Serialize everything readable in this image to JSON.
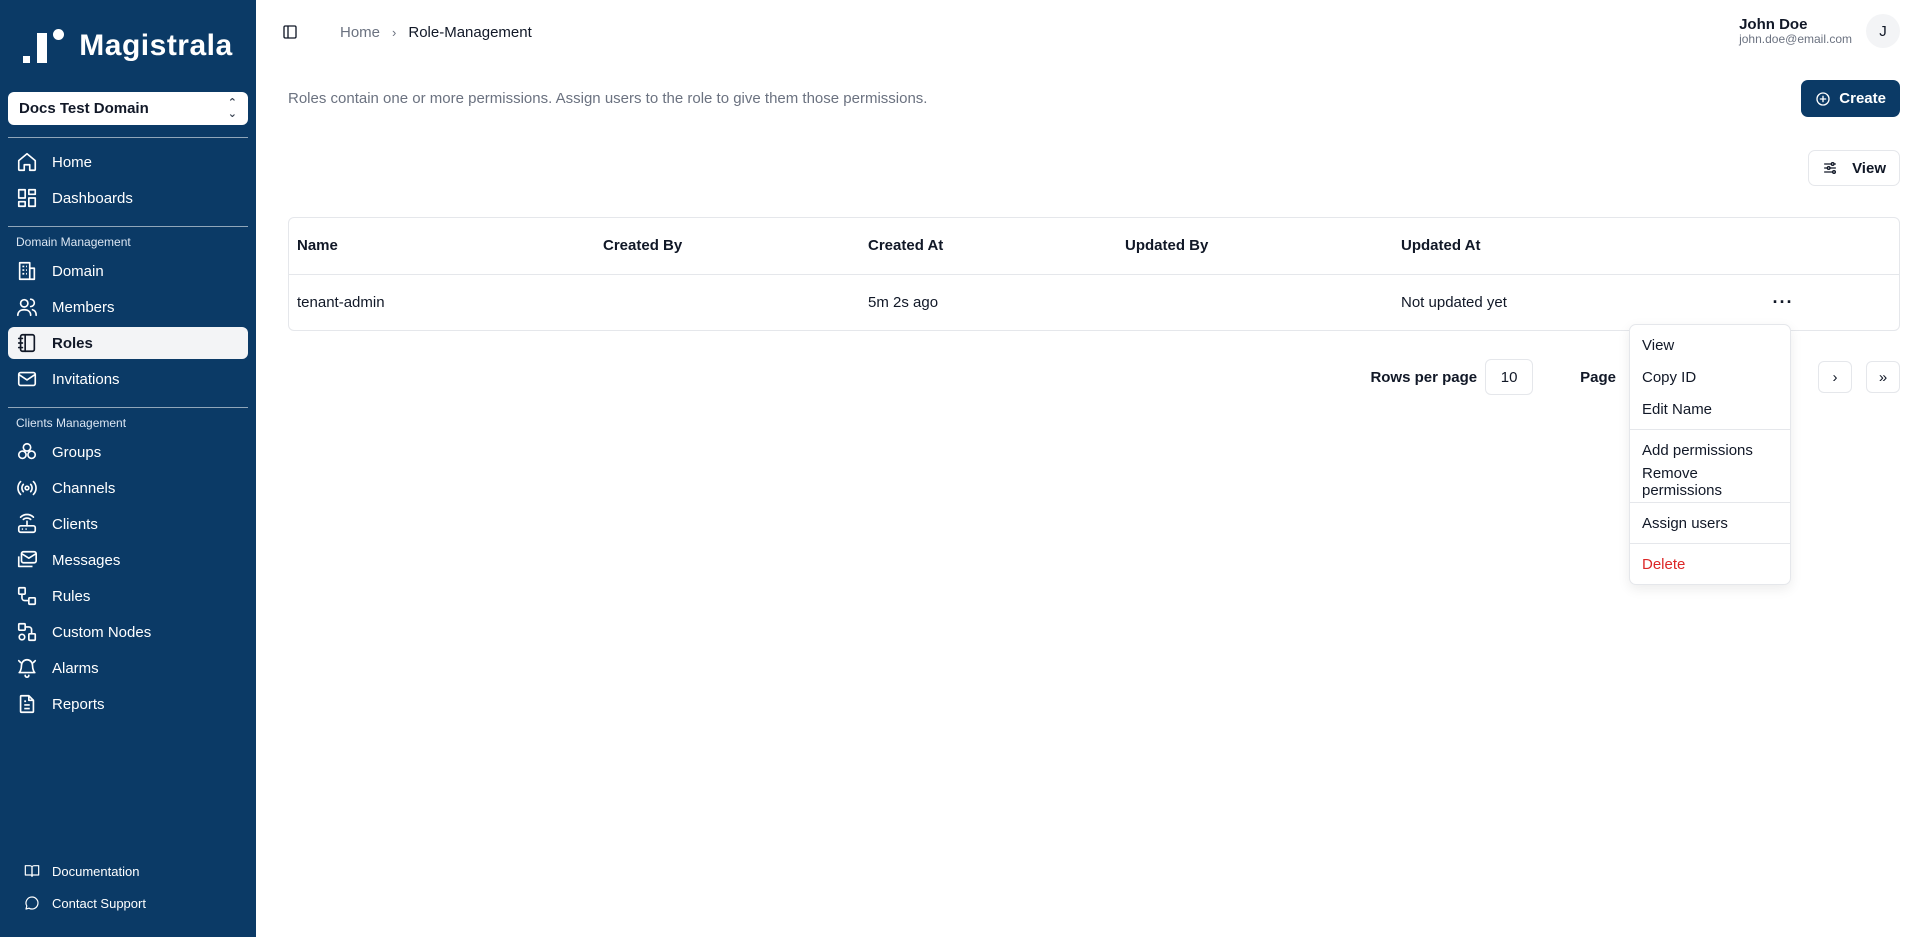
{
  "brand": {
    "name": "Magistrala"
  },
  "domain_selector": {
    "value": "Docs Test Domain"
  },
  "sidebar": {
    "main_items": [
      {
        "label": "Home",
        "icon": "home-icon"
      },
      {
        "label": "Dashboards",
        "icon": "dashboard-icon"
      }
    ],
    "domain_section": {
      "label": "Domain Management",
      "items": [
        {
          "label": "Domain",
          "icon": "building-icon"
        },
        {
          "label": "Members",
          "icon": "users-icon"
        },
        {
          "label": "Roles",
          "icon": "notebook-icon",
          "active": true
        },
        {
          "label": "Invitations",
          "icon": "mail-icon"
        }
      ]
    },
    "clients_section": {
      "label": "Clients Management",
      "items": [
        {
          "label": "Groups",
          "icon": "groups-icon"
        },
        {
          "label": "Channels",
          "icon": "radio-icon"
        },
        {
          "label": "Clients",
          "icon": "router-icon"
        },
        {
          "label": "Messages",
          "icon": "messages-icon"
        },
        {
          "label": "Rules",
          "icon": "workflow-icon"
        },
        {
          "label": "Custom Nodes",
          "icon": "nodes-icon"
        },
        {
          "label": "Alarms",
          "icon": "bell-icon"
        },
        {
          "label": "Reports",
          "icon": "file-icon"
        }
      ]
    },
    "bottom_items": [
      {
        "label": "Documentation",
        "icon": "book-icon"
      },
      {
        "label": "Contact Support",
        "icon": "chat-icon"
      }
    ]
  },
  "header": {
    "breadcrumb": {
      "home": "Home",
      "separator": "›",
      "current": "Role-Management"
    },
    "user": {
      "name": "John Doe",
      "email": "john.doe@email.com",
      "initial": "J"
    }
  },
  "page": {
    "description": "Roles contain one or more permissions. Assign users to the role to give them those permissions.",
    "create_label": "Create",
    "view_label": "View"
  },
  "table": {
    "columns": [
      "Name",
      "Created By",
      "Created At",
      "Updated By",
      "Updated At"
    ],
    "rows": [
      {
        "name": "tenant-admin",
        "created_by": "",
        "created_at": "5m 2s ago",
        "updated_by": "",
        "updated_at": "Not updated yet",
        "actions": "···"
      }
    ]
  },
  "pagination": {
    "rows_per_page_label": "Rows per page",
    "rows_per_page_value": "10",
    "page_label": "Page",
    "next": "›",
    "last": "»"
  },
  "context_menu": {
    "items": [
      "View",
      "Copy ID",
      "Edit Name",
      "Add permissions",
      "Remove permissions",
      "Assign users",
      "Delete"
    ]
  },
  "colors": {
    "sidebar_bg": "#0b3a66",
    "primary": "#0b3a66",
    "danger": "#dc2626"
  }
}
